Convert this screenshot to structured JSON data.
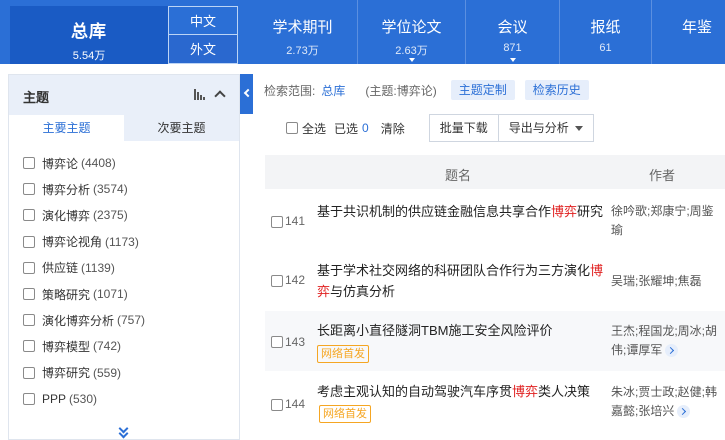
{
  "header": {
    "main_db": {
      "label": "总库",
      "count": "5.54万"
    },
    "lang": {
      "zh": "中文",
      "foreign": "外文"
    },
    "tabs": [
      {
        "label": "学术期刊",
        "count": "2.73万"
      },
      {
        "label": "学位论文",
        "count": "2.63万"
      },
      {
        "label": "会议",
        "count": "871"
      },
      {
        "label": "报纸",
        "count": "61"
      },
      {
        "label": "年鉴",
        "count": ""
      }
    ]
  },
  "facet_panel": {
    "title": "主题",
    "subtabs": {
      "primary": "主要主题",
      "secondary": "次要主题"
    },
    "items": [
      {
        "label": "博弈论",
        "count": "(4408)"
      },
      {
        "label": "博弈分析",
        "count": "(3574)"
      },
      {
        "label": "演化博弈",
        "count": "(2375)"
      },
      {
        "label": "博弈论视角",
        "count": "(1173)"
      },
      {
        "label": "供应链",
        "count": "(1139)"
      },
      {
        "label": "策略研究",
        "count": "(1071)"
      },
      {
        "label": "演化博弈分析",
        "count": "(757)"
      },
      {
        "label": "博弈模型",
        "count": "(742)"
      },
      {
        "label": "博弈研究",
        "count": "(559)"
      },
      {
        "label": "PPP",
        "count": "(530)"
      }
    ]
  },
  "scope": {
    "label": "检索范围:",
    "db": "总库",
    "condition": "(主题:博弈论)",
    "custom_btn": "主题定制",
    "history_btn": "检索历史"
  },
  "toolbar": {
    "select_all": "全选",
    "selected_label": "已选",
    "selected_count": "0",
    "clear": "清除",
    "batch_download": "批量下载",
    "export": "导出与分析"
  },
  "table": {
    "col_title": "题名",
    "col_author": "作者",
    "rows": [
      {
        "num": "141",
        "title_before": "基于共识机制的供应链金融信息共享合作",
        "keyword": "博弈",
        "title_after": "研究",
        "badge": "",
        "authors": "徐吟歌;郑康宁;周鉴瑜"
      },
      {
        "num": "142",
        "title_before": "基于学术社交网络的科研团队合作行为三方演化",
        "keyword": "博弈",
        "title_after": "与仿真分析",
        "badge": "",
        "authors": "吴瑞;张耀坤;焦磊"
      },
      {
        "num": "143",
        "title_before": "长距离小直径隧洞TBM施工安全风险评价",
        "keyword": "",
        "title_after": "",
        "badge": "网络首发",
        "authors": "王杰;程国龙;周冰;胡伟;谭厚军"
      },
      {
        "num": "144",
        "title_before": "考虑主观认知的自动驾驶汽车序贯",
        "keyword": "博弈",
        "title_after": "类人决策",
        "badge": "网络首发",
        "authors": "朱冰;贾士政;赵健;韩嘉懿;张培兴"
      }
    ]
  },
  "colors": {
    "brand": "#2b6fd6",
    "brand_dark": "#1a5bc4",
    "keyword": "#e02020",
    "badge": "#f5a623"
  }
}
